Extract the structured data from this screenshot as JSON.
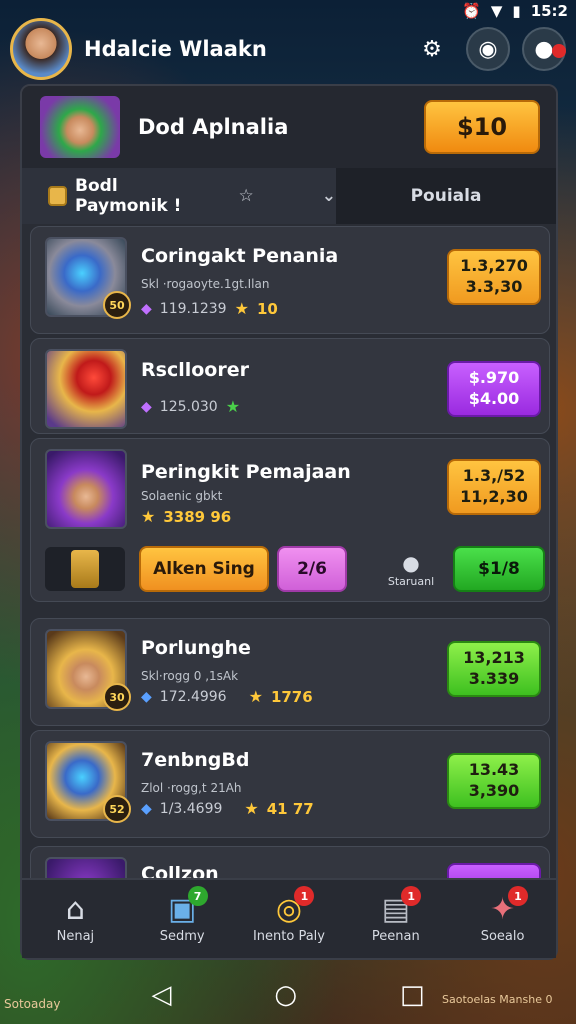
{
  "status_bar": {
    "time": "15:2",
    "icons": [
      "alarm-icon",
      "wifi-icon",
      "battery-icon"
    ]
  },
  "header": {
    "title": "Hdalcie Wlaakn",
    "icons": [
      "gear-icon",
      "settings-wheel-icon",
      "cookie-icon"
    ]
  },
  "profile": {
    "name": "Dod Aplnalia",
    "price": "$10"
  },
  "tabs": {
    "left_label": "Bodl Paymonik !",
    "left_icon": "sparkle-icon",
    "right_label": "Pouiala"
  },
  "items": [
    {
      "title": "Coringakt Penania",
      "subtitle": "Skl ·rogaoyte.1gt.Ilan",
      "gems": "119.1239",
      "score": "10",
      "badge": "50",
      "price_top": "1.3,270",
      "price_bottom": "3.3,30",
      "price_color": "orange"
    },
    {
      "title": "Rsclloorer",
      "subtitle": "",
      "gems": "125.030",
      "score": "",
      "badge": "",
      "price_top": "$.970",
      "price_bottom": "$4.00",
      "price_color": "purple"
    },
    {
      "title": "Peringkit Pemajaan",
      "subtitle": "Solaenic gbkt",
      "gems": "",
      "score": "3389 96",
      "badge": "",
      "price_top": "1.3,/52",
      "price_bottom": "11,2,30",
      "price_color": "orange",
      "actions": {
        "alt_button": "Alken Sing",
        "pink_button": "2/6",
        "status_label": "Staruanl",
        "green_button": "$1/8"
      }
    },
    {
      "title": "Porlunghe",
      "subtitle": "Skl·rogg 0 ,1sAk",
      "gems": "172.4996",
      "score": "1776",
      "badge": "30",
      "price_top": "13,213",
      "price_bottom": "3.339",
      "price_color": "green"
    },
    {
      "title": "7enbngBd",
      "subtitle": "Zlol ·rogg,t 21Ah",
      "gems": "1/3.4699",
      "score": "41 77",
      "badge": "52",
      "price_top": "13.43",
      "price_bottom": "3,390",
      "price_color": "green"
    },
    {
      "title": "Collzon",
      "subtitle": "",
      "gems": "",
      "score": "",
      "badge": "",
      "price_top": "",
      "price_bottom": "",
      "price_color": "purple"
    }
  ],
  "bottom_nav": [
    {
      "label": "Nenaj",
      "icon": "home-icon",
      "badge": ""
    },
    {
      "label": "Sedmy",
      "icon": "box-icon",
      "badge": "7"
    },
    {
      "label": "Inento Paly",
      "icon": "coin-icon",
      "badge": "1"
    },
    {
      "label": "Peenan",
      "icon": "package-icon",
      "badge": "1"
    },
    {
      "label": "Soealo",
      "icon": "puzzle-icon",
      "badge": "1"
    }
  ],
  "background_text": {
    "left": "Sotoaday",
    "right": "Saotoelas Manshe 0"
  },
  "system_nav": [
    "back-icon",
    "home-circle-icon",
    "recent-apps-icon"
  ]
}
